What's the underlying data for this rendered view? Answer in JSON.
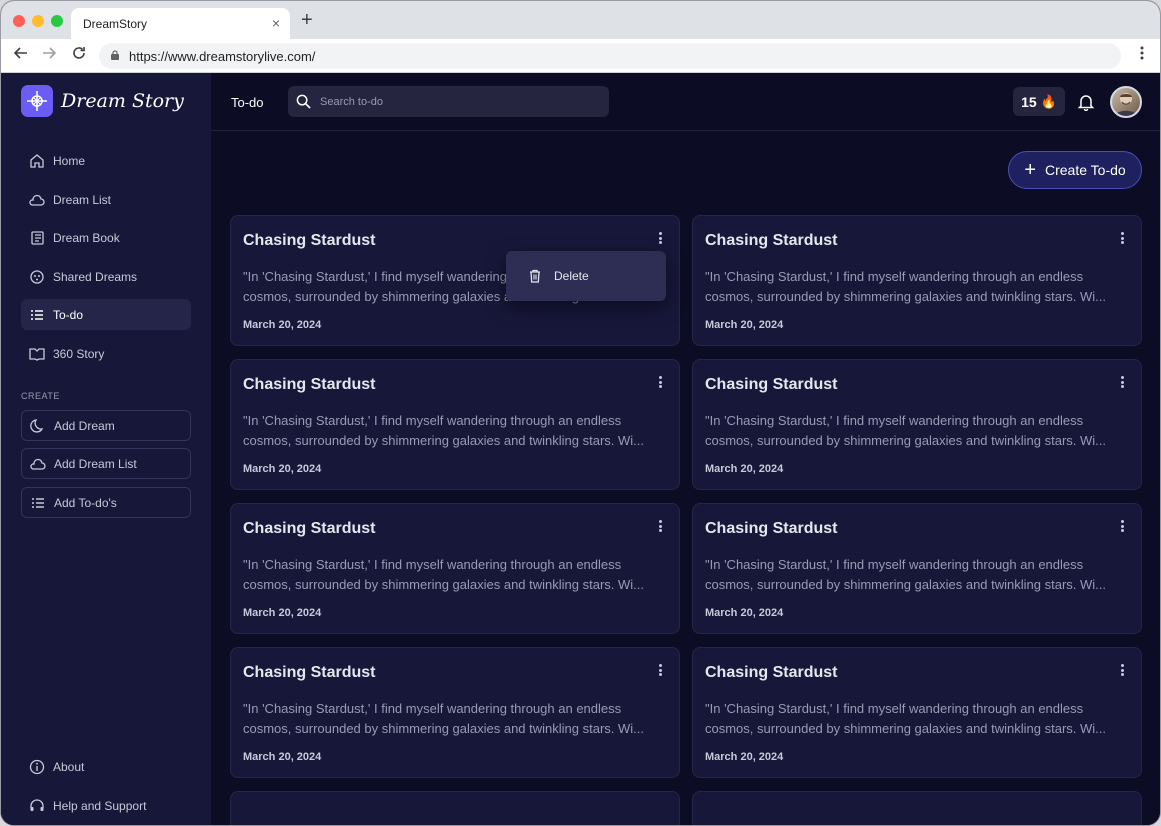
{
  "browser": {
    "tab_title": "DreamStory",
    "tab_close": "×",
    "new_tab": "+",
    "url": "https://www.dreamstorylive.com/"
  },
  "brand": {
    "name": "Dream Story"
  },
  "sidebar": {
    "items": [
      {
        "label": "Home",
        "icon": "home-icon"
      },
      {
        "label": "Dream List",
        "icon": "moon-cloud-icon"
      },
      {
        "label": "Dream Book",
        "icon": "book-icon"
      },
      {
        "label": "Shared Dreams",
        "icon": "share-icon"
      },
      {
        "label": "To-do",
        "icon": "list-icon",
        "active": true
      },
      {
        "label": "360 Story",
        "icon": "open-book-icon"
      }
    ],
    "create_label": "CREATE",
    "create_items": [
      {
        "label": "Add Dream",
        "icon": "moon-icon"
      },
      {
        "label": "Add Dream List",
        "icon": "moon-cloud-icon"
      },
      {
        "label": "Add To-do's",
        "icon": "list-icon"
      }
    ],
    "bottom_items": [
      {
        "label": "About",
        "icon": "info-icon"
      },
      {
        "label": "Help and Support",
        "icon": "headset-icon"
      }
    ]
  },
  "header": {
    "title": "To-do",
    "search_placeholder": "Search to-do",
    "streak_count": "15",
    "streak_icon": "🔥"
  },
  "create_button": {
    "label": "Create To-do"
  },
  "dropdown": {
    "delete_label": "Delete"
  },
  "cards": [
    {
      "title": "Chasing Stardust",
      "description": "\"In 'Chasing Stardust,' I find myself wandering through an endless cosmos, surrounded by shimmering galaxies and twinkling stars. Wi...",
      "date": "March 20, 2024"
    },
    {
      "title": "Chasing Stardust",
      "description": "\"In 'Chasing Stardust,' I find myself wandering through an endless cosmos, surrounded by shimmering galaxies and twinkling stars. Wi...",
      "date": "March 20, 2024"
    },
    {
      "title": "Chasing Stardust",
      "description": "\"In 'Chasing Stardust,' I find myself wandering through an endless cosmos, surrounded by shimmering galaxies and twinkling stars. Wi...",
      "date": "March 20, 2024"
    },
    {
      "title": "Chasing Stardust",
      "description": "\"In 'Chasing Stardust,' I find myself wandering through an endless cosmos, surrounded by shimmering galaxies and twinkling stars. Wi...",
      "date": "March 20, 2024"
    },
    {
      "title": "Chasing Stardust",
      "description": "\"In 'Chasing Stardust,' I find myself wandering through an endless cosmos, surrounded by shimmering galaxies and twinkling stars. Wi...",
      "date": "March 20, 2024"
    },
    {
      "title": "Chasing Stardust",
      "description": "\"In 'Chasing Stardust,' I find myself wandering through an endless cosmos, surrounded by shimmering galaxies and twinkling stars. Wi...",
      "date": "March 20, 2024"
    },
    {
      "title": "Chasing Stardust",
      "description": "\"In 'Chasing Stardust,' I find myself wandering through an endless cosmos, surrounded by shimmering galaxies and twinkling stars. Wi...",
      "date": "March 20, 2024"
    },
    {
      "title": "Chasing Stardust",
      "description": "\"In 'Chasing Stardust,' I find myself wandering through an endless cosmos, surrounded by shimmering galaxies and twinkling stars. Wi...",
      "date": "March 20, 2024"
    }
  ],
  "colors": {
    "background": "#0c0c24",
    "sidebar": "#17173a",
    "card": "#17173a",
    "accent": "#6a5cf5",
    "create_button_border": "#4a4fb8"
  }
}
